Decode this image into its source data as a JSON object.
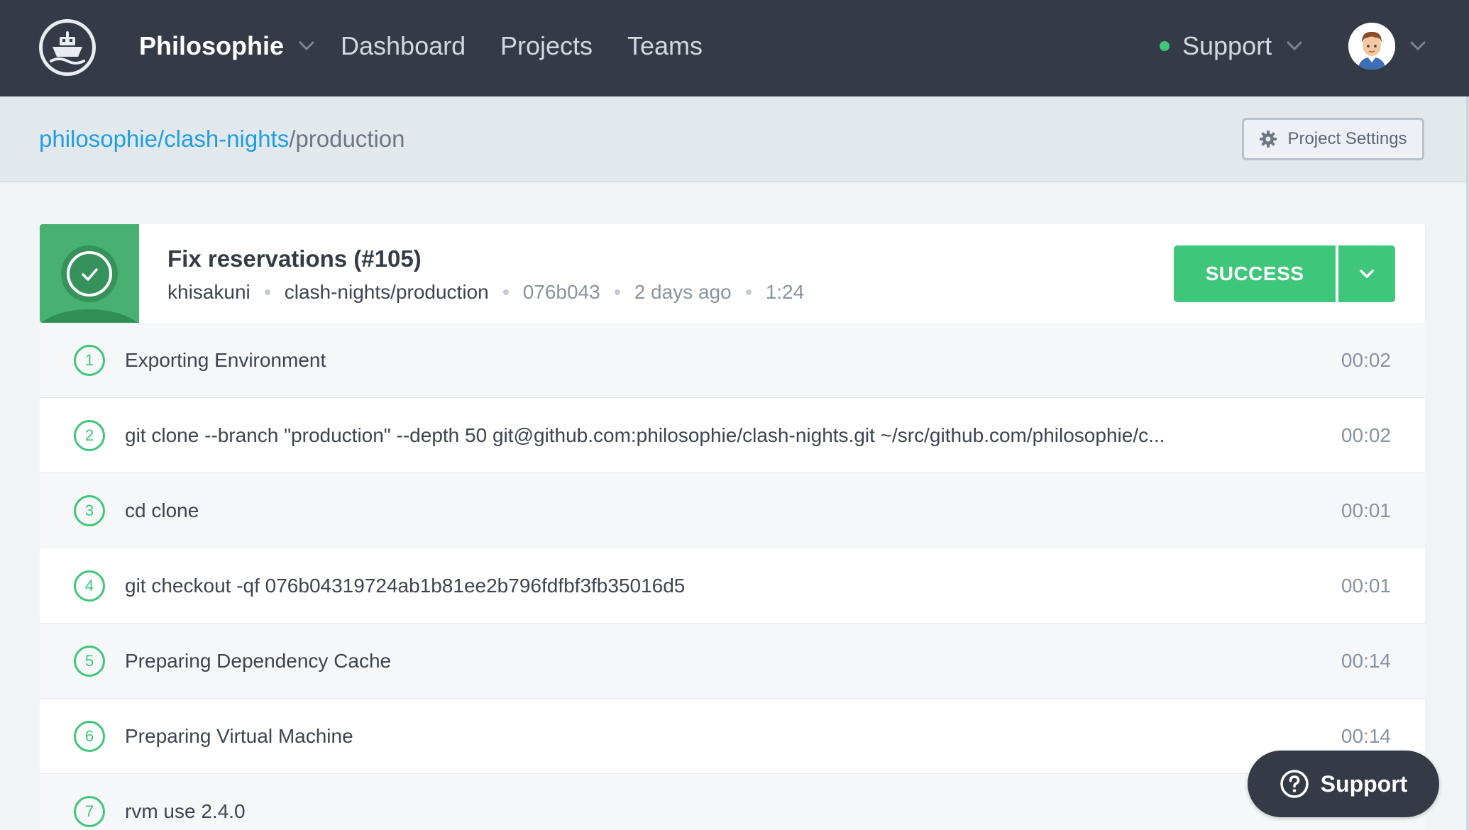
{
  "nav": {
    "org_name": "Philosophie",
    "links": [
      "Dashboard",
      "Projects",
      "Teams"
    ],
    "support_label": "Support",
    "support_status_color": "#3ec77a",
    "logo_icon": "ship-icon",
    "avatar_icon": "user-avatar"
  },
  "breadcrumb": {
    "org": "philosophie",
    "sep1": "/",
    "repo": "clash-nights",
    "sep2": "/",
    "env": "production",
    "settings_label": "Project Settings",
    "settings_icon": "gear-icon"
  },
  "build": {
    "title": "Fix reservations (#105)",
    "author": "khisakuni",
    "branch": "clash-nights/production",
    "commit": "076b043",
    "time_ago": "2 days ago",
    "duration": "1:24",
    "status_label": "SUCCESS",
    "status_color": "#3ec77a"
  },
  "steps": [
    {
      "num": "1",
      "command": "Exporting Environment",
      "time": "00:02"
    },
    {
      "num": "2",
      "command": "git clone --branch \"production\" --depth 50 git@github.com:philosophie/clash-nights.git ~/src/github.com/philosophie/c...",
      "time": "00:02"
    },
    {
      "num": "3",
      "command": "cd clone",
      "time": "00:01"
    },
    {
      "num": "4",
      "command": "git checkout -qf 076b04319724ab1b81ee2b796fdfbf3fb35016d5",
      "time": "00:01"
    },
    {
      "num": "5",
      "command": "Preparing Dependency Cache",
      "time": "00:14"
    },
    {
      "num": "6",
      "command": "Preparing Virtual Machine",
      "time": "00:14"
    },
    {
      "num": "7",
      "command": "rvm use 2.4.0",
      "time": ""
    }
  ],
  "support_fab": {
    "label": "Support",
    "icon": "question-circle-icon"
  }
}
